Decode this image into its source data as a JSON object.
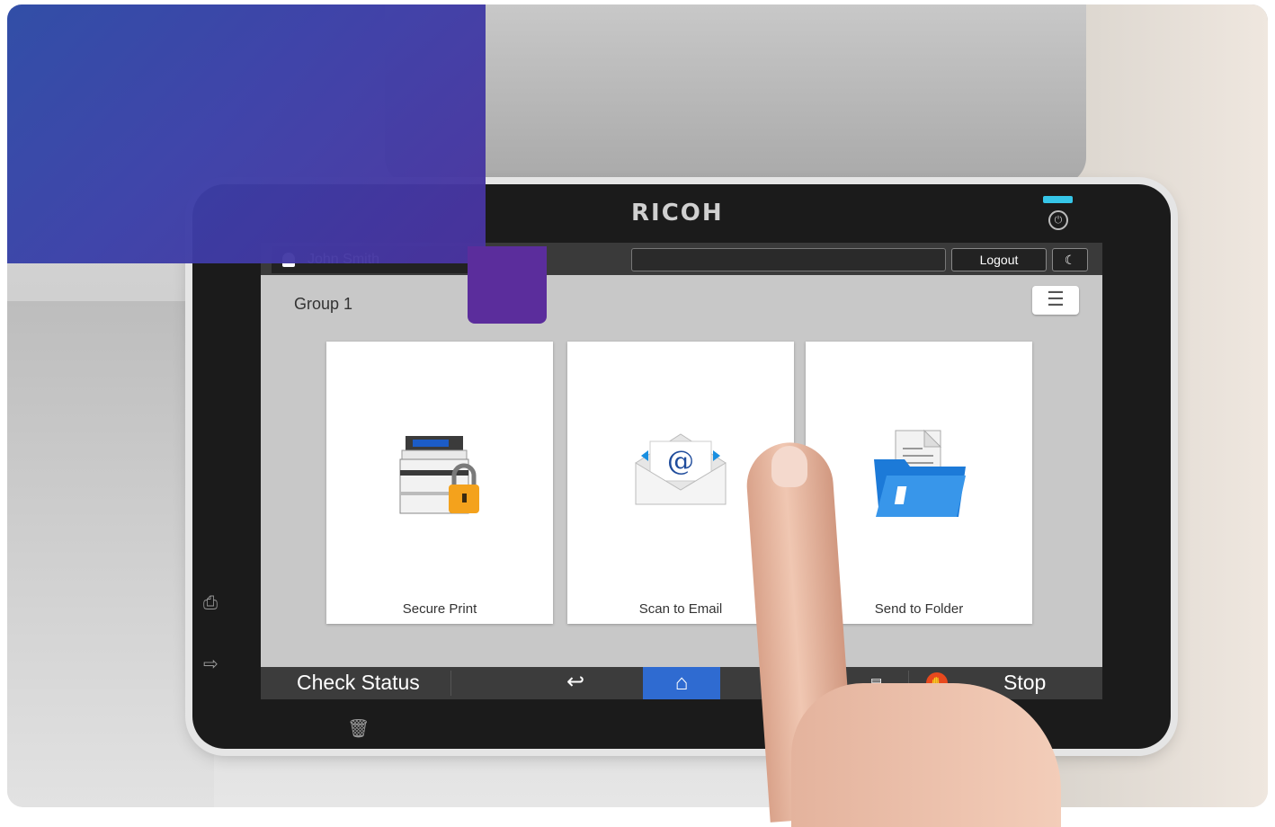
{
  "device": {
    "brand": "RICOH"
  },
  "header": {
    "user_name": "John Smith",
    "logout_label": "Logout",
    "sleep_icon": "moon-icon",
    "message_value": ""
  },
  "panel": {
    "group_title": "Group 1",
    "menu_icon": "list-menu-icon"
  },
  "tiles": [
    {
      "label": "Secure Print",
      "icon": "printer-lock-icon"
    },
    {
      "label": "Scan to Email",
      "icon": "email-envelope-icon"
    },
    {
      "label": "Send to Folder",
      "icon": "folder-document-icon"
    }
  ],
  "footer": {
    "check_status_label": "Check Status",
    "back_icon": "back-arrow-icon",
    "home_icon": "home-icon",
    "counter_icon": "counter-icon",
    "stop_icon": "stop-icon",
    "stop_label": "Stop"
  },
  "colors": {
    "home_active": "#2f6bd1",
    "stop_icon": "#e8491d",
    "overlay_blue": "#2c4aa6",
    "overlay_purple": "#5b2d9c"
  }
}
